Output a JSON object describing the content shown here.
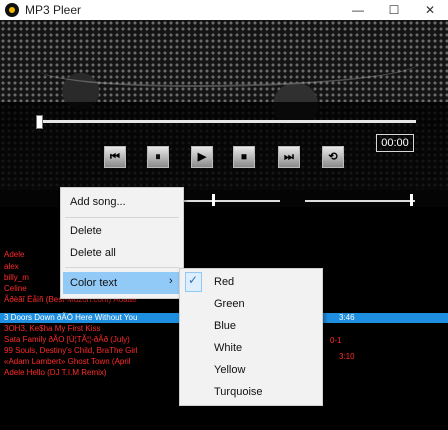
{
  "window": {
    "title": "MP3 Pleer",
    "minimize_glyph": "—",
    "maximize_glyph": "☐",
    "close_glyph": "✕"
  },
  "player": {
    "time": "00:00",
    "position_fraction": 0.0,
    "volume_fraction": 0.3,
    "balance_fraction": 0.97
  },
  "controls": [
    {
      "name": "prev",
      "glyph": "⏮"
    },
    {
      "name": "pause",
      "glyph": "⏸"
    },
    {
      "name": "play",
      "glyph": "▶"
    },
    {
      "name": "stop",
      "glyph": "⏹"
    },
    {
      "name": "next",
      "glyph": "⏭"
    },
    {
      "name": "shuffle",
      "glyph": "⟲"
    }
  ],
  "playlist": {
    "rows": [
      "Adele",
      "alex",
      "billy_m",
      "Celine",
      "Ãðèãî Ëåïñ (Best-Muzon.com) Áóãåé",
      "3OH3, Ke$ha My First Kiss",
      "Sata Family ðÃO [Ù¦TÃ¦¦-ðÃð (July)",
      "99 Souls, Destiny's Child, BraThe Girl",
      "«Adam Lambert» Ghost Town (April",
      "Adele Hello (DJ T.I.M Remix)"
    ],
    "selected": {
      "name": "3 Doors Down ðÃÖ Here Without You",
      "duration": "3:46"
    },
    "right_values": [
      "0-1",
      "3:10"
    ]
  },
  "context_menu": {
    "items": [
      "Add song...",
      "Delete",
      "Delete all",
      "Color text"
    ],
    "submenu_arrow": "›"
  },
  "color_submenu": {
    "items": [
      "Red",
      "Green",
      "Blue",
      "White",
      "Yellow",
      "Turquoise"
    ],
    "checked": "Red",
    "check_glyph": "✓"
  }
}
